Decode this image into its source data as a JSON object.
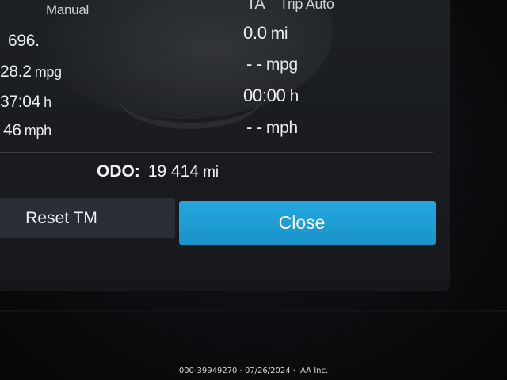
{
  "left_column": {
    "header": "Manual",
    "rows": [
      {
        "value": "696.",
        "unit": ""
      },
      {
        "value": "28.2",
        "unit": "mpg"
      },
      {
        "value": "37:04",
        "unit": "h"
      },
      {
        "value": "46",
        "unit": "mph"
      }
    ]
  },
  "right_column": {
    "header_tag": "TA",
    "header": "Trip Auto",
    "rows": [
      {
        "value": "0.0",
        "unit": "mi"
      },
      {
        "value": "- -",
        "unit": "mpg"
      },
      {
        "value": "00:00",
        "unit": "h"
      },
      {
        "value": "- -",
        "unit": "mph"
      }
    ]
  },
  "odometer": {
    "label": "ODO:",
    "value": "19 414",
    "unit": "mi"
  },
  "buttons": {
    "reset_label": "Reset TM",
    "close_label": "Close"
  },
  "colors": {
    "close_button": "#1e9bd2",
    "reset_button": "#2a2d33",
    "screen_background": "#1b1e22"
  },
  "watermark": "000-39949270 · 07/26/2024 · IAA Inc."
}
